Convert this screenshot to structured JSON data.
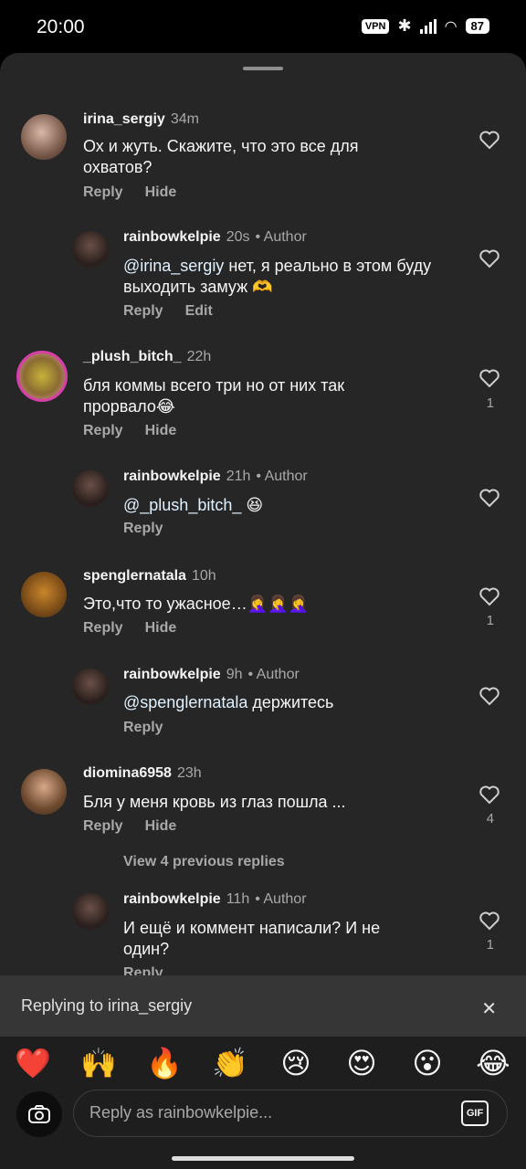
{
  "status": {
    "time": "20:00",
    "vpn": "VPN",
    "battery": "87"
  },
  "comments": [
    {
      "username": "irina_sergiy",
      "time": "34m",
      "author": "",
      "text": "Ох и жуть. Скажите, что это все для охватов?",
      "mention": "",
      "actions": [
        "Reply",
        "Hide"
      ],
      "likes": ""
    },
    {
      "username": "rainbowkelpie",
      "time": "20s",
      "author": "• Author",
      "mention": "@irina_sergiy",
      "text": " нет, я реально в этом буду выходить замуж 🫶",
      "actions": [
        "Reply",
        "Edit"
      ],
      "likes": ""
    },
    {
      "username": "_plush_bitch_",
      "time": "22h",
      "author": "",
      "text": "бля коммы всего три но от них так прорвало😂",
      "mention": "",
      "actions": [
        "Reply",
        "Hide"
      ],
      "likes": "1"
    },
    {
      "username": "rainbowkelpie",
      "time": "21h",
      "author": "• Author",
      "mention": "@_plush_bitch_",
      "text": " 😆",
      "actions": [
        "Reply"
      ],
      "likes": ""
    },
    {
      "username": "spenglernatala",
      "time": "10h",
      "author": "",
      "text": "Это,что то ужасное…🤦‍♀️🤦‍♀️🤦‍♀️",
      "mention": "",
      "actions": [
        "Reply",
        "Hide"
      ],
      "likes": "1"
    },
    {
      "username": "rainbowkelpie",
      "time": "9h",
      "author": "• Author",
      "mention": "@spenglernatala",
      "text": " держитесь",
      "actions": [
        "Reply"
      ],
      "likes": ""
    },
    {
      "username": "diomina6958",
      "time": "23h",
      "author": "",
      "text": "Бля у меня кровь из глаз пошла ...",
      "mention": "",
      "actions": [
        "Reply",
        "Hide"
      ],
      "likes": "4"
    },
    {
      "username": "rainbowkelpie",
      "time": "11h",
      "author": "• Author",
      "mention": "",
      "text": "И ещё и коммент написали? И не один?",
      "actions": [
        "Reply"
      ],
      "likes": "1"
    }
  ],
  "view_previous": "View 4 previous replies",
  "reply_bar": {
    "text": "Replying to irina_sergiy"
  },
  "emojis": [
    "❤️",
    "🙌",
    "🔥",
    "👏",
    "😢",
    "😍",
    "😮",
    "😂"
  ],
  "composer": {
    "placeholder": "Reply as rainbowkelpie...",
    "gif": "GIF"
  },
  "icons": {
    "like": "heart-outline-icon",
    "close": "close-icon",
    "camera": "camera-icon"
  }
}
